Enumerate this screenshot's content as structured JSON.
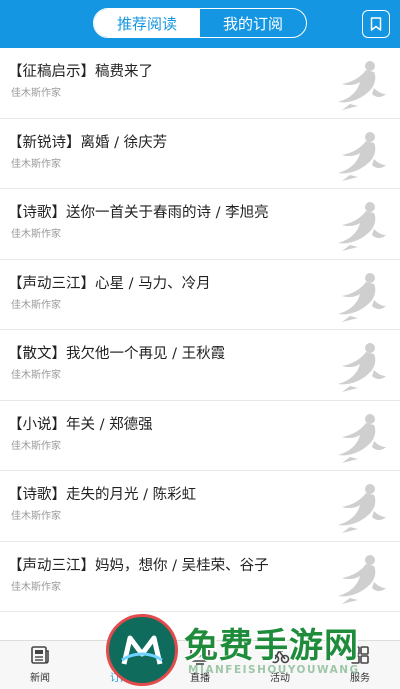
{
  "header": {
    "tabs": [
      {
        "label": "推荐阅读",
        "active": true
      },
      {
        "label": "我的订阅",
        "active": false
      }
    ],
    "bookmark_icon": "bookmark-icon"
  },
  "articles": [
    {
      "title": "【征稿启示】稿费来了",
      "author": "佳木斯作家"
    },
    {
      "title": "【新锐诗】离婚 / 徐庆芳",
      "author": "佳木斯作家"
    },
    {
      "title": "【诗歌】送你一首关于春雨的诗 / 李旭亮",
      "author": "佳木斯作家"
    },
    {
      "title": "【声动三江】心星 / 马力、冷月",
      "author": "佳木斯作家"
    },
    {
      "title": "【散文】我欠他一个再见 / 王秋霞",
      "author": "佳木斯作家"
    },
    {
      "title": "【小说】年关 / 郑德强",
      "author": "佳木斯作家"
    },
    {
      "title": "【诗歌】走失的月光 / 陈彩虹",
      "author": "佳木斯作家"
    },
    {
      "title": "【声动三江】妈妈，想你 / 吴桂荣、谷子",
      "author": "佳木斯作家"
    }
  ],
  "tabbar": {
    "items": [
      {
        "label": "新闻",
        "icon": "newspaper-icon",
        "active": false
      },
      {
        "label": "订阅",
        "icon": "subscribe-icon",
        "active": true
      },
      {
        "label": "直播",
        "icon": "tv-icon",
        "active": false
      },
      {
        "label": "活动",
        "icon": "activity-icon",
        "active": false
      },
      {
        "label": "服务",
        "icon": "grid-icon",
        "active": false
      }
    ]
  },
  "watermark": {
    "main_text": "免费手游网",
    "sub_text": "MIANFEISHOUYOUWANG"
  },
  "colors": {
    "brand": "#1596e3",
    "watermark_green": "#1e8c3a"
  }
}
